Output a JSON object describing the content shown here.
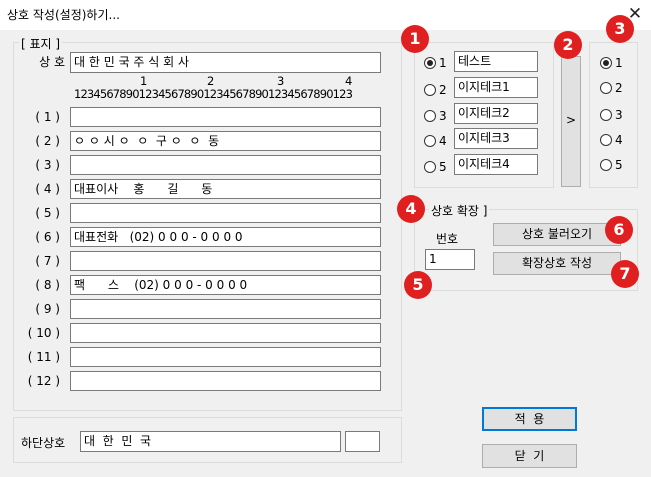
{
  "window": {
    "title": "상호 작성(설정)하기...",
    "close_glyph": "✕"
  },
  "signboard": {
    "group_label": "[ 표지 ]",
    "name_label": "상 호",
    "name_value": "대 한 민 국 주 식 회 사",
    "ruler_tens": [
      "1",
      "2",
      "3",
      "4"
    ],
    "ruler_digits": "1234567890123456789012345678901234567890123",
    "lines": [
      {
        "label": "( 1 )",
        "value": ""
      },
      {
        "label": "( 2 )",
        "value": "ㅇ ㅇ 시 ㅇ  ㅇ  구 ㅇ  ㅇ  동"
      },
      {
        "label": "( 3 )",
        "value": ""
      },
      {
        "label": "( 4 )",
        "value": "대표이사    홍      길      동"
      },
      {
        "label": "( 5 )",
        "value": ""
      },
      {
        "label": "( 6 )",
        "value": "대표전화   (02) 0 0 0 - 0 0 0 0"
      },
      {
        "label": "( 7 )",
        "value": ""
      },
      {
        "label": "( 8 )",
        "value": "팩      스    (02) 0 0 0 - 0 0 0 0"
      },
      {
        "label": "( 9 )",
        "value": ""
      },
      {
        "label": "( 10 )",
        "value": ""
      },
      {
        "label": "( 11 )",
        "value": ""
      },
      {
        "label": "( 12 )",
        "value": ""
      }
    ]
  },
  "bottom": {
    "label": "하단상호",
    "value": "대  한  민  국",
    "extra_value": ""
  },
  "presets": {
    "items": [
      {
        "num": "1",
        "name": "테스트",
        "checked": true
      },
      {
        "num": "2",
        "name": "이지테크1",
        "checked": false
      },
      {
        "num": "3",
        "name": "이지테크2",
        "checked": false
      },
      {
        "num": "4",
        "name": "이지테크3",
        "checked": false
      },
      {
        "num": "5",
        "name": "이지테크4",
        "checked": false
      }
    ]
  },
  "apply_arrow": {
    "label": ">"
  },
  "targets": {
    "items": [
      {
        "num": "1",
        "checked": true
      },
      {
        "num": "2",
        "checked": false
      },
      {
        "num": "3",
        "checked": false
      },
      {
        "num": "4",
        "checked": false
      },
      {
        "num": "5",
        "checked": false
      }
    ]
  },
  "extension": {
    "group_label": "상호 확장 ]",
    "number_label": "번호",
    "number_value": "1",
    "load_button": "상호 불러오기",
    "create_button": "확장상호 작성"
  },
  "actions": {
    "apply": "적  용",
    "close": "닫  기"
  },
  "badges": [
    "1",
    "2",
    "3",
    "4",
    "5",
    "6",
    "7"
  ],
  "colors": {
    "badge": "#e02020",
    "default_button_border": "#0078d7"
  }
}
